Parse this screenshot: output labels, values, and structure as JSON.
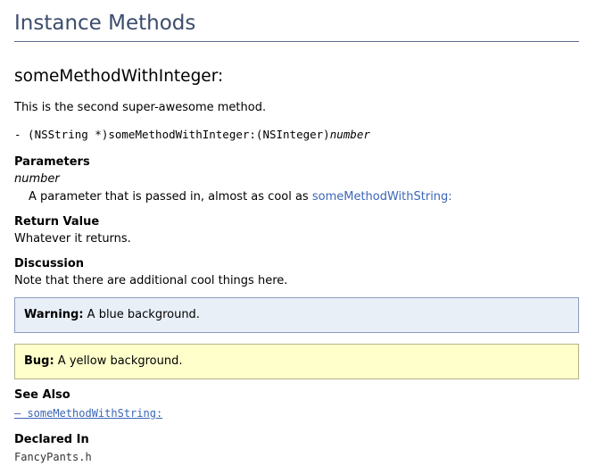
{
  "section": {
    "title": "Instance Methods"
  },
  "method": {
    "name": "someMethodWithInteger:",
    "abstract": "This is the second super-awesome method.",
    "declaration": {
      "prefix": "- (NSString *)someMethodWithInteger:(NSInteger)",
      "param_name": "number"
    }
  },
  "parameters": {
    "heading": "Parameters",
    "items": [
      {
        "name": "number",
        "description": "A parameter that is passed in, almost as cool as ",
        "link_label": "someMethodWithString:"
      }
    ]
  },
  "return_value": {
    "heading": "Return Value",
    "text": "Whatever it returns."
  },
  "discussion": {
    "heading": "Discussion",
    "text": "Note that there are additional cool things here."
  },
  "warning": {
    "label": "Warning:",
    "text": " A blue background."
  },
  "bug": {
    "label": "Bug:",
    "text": " A yellow background."
  },
  "see_also": {
    "heading": "See Also",
    "links": [
      {
        "label": "– someMethodWithString:"
      }
    ]
  },
  "declared_in": {
    "heading": "Declared In",
    "file": "FancyPants.h"
  },
  "colors": {
    "section_title": "#3c4c6c",
    "link": "#3b66b8",
    "warning_background": "#e9eff7",
    "bug_background": "#ffffcc"
  }
}
